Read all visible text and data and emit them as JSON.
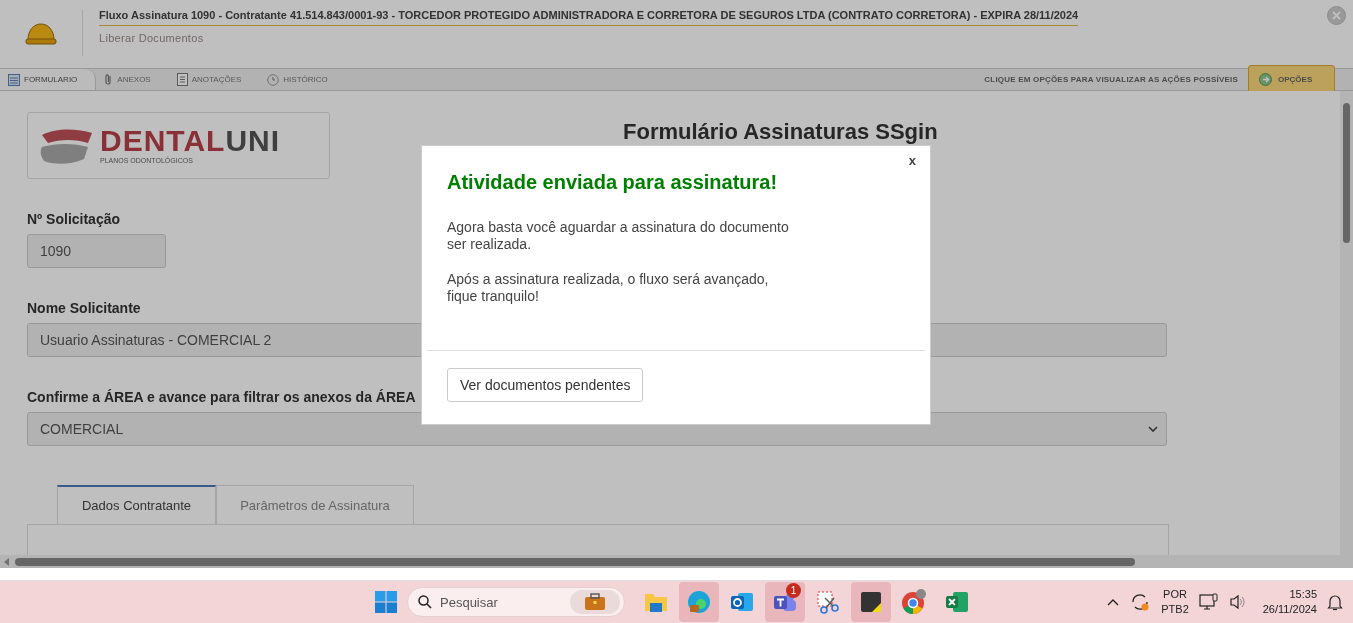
{
  "header": {
    "title": "Fluxo Assinatura 1090 - Contratante 41.514.843/0001-93 - TORCEDOR PROTEGIDO ADMINISTRADORA E CORRETORA DE SEGUROS LTDA (CONTRATO CORRETORA) - EXPIRA 28/11/2024",
    "subtitle": "Liberar Documentos"
  },
  "tabs": [
    {
      "label": "FORMULARIO",
      "kind": "form",
      "selected": true
    },
    {
      "label": "ANEXOS",
      "kind": "clip",
      "selected": false
    },
    {
      "label": "ANOTAÇÕES",
      "kind": "notes",
      "selected": false
    },
    {
      "label": "HISTÓRICO",
      "kind": "clock",
      "selected": false
    }
  ],
  "hint": "CLIQUE EM OPÇÕES PARA VISUALIZAR AS AÇÕES POSSÍVEIS",
  "options_button": "OPÇÕES",
  "logo": {
    "brand_first": "DENTAL",
    "brand_second": "UNI",
    "tagline": "PLANOS ODONTOLÓGICOS"
  },
  "form": {
    "title": "Formulário Assinaturas SSgin",
    "fields": [
      {
        "label": "Nº Solicitação",
        "value": "1090",
        "kind": "short"
      },
      {
        "label": "Nome Solicitante",
        "value": "Usuario Assinaturas - COMERCIAL 2",
        "kind": "wide"
      },
      {
        "label": "Confirme a ÁREA e avance para filtrar os anexos da ÁREA",
        "value": "COMERCIAL",
        "kind": "select"
      }
    ],
    "subtabs": [
      {
        "label": "Dados Contratante",
        "selected": true
      },
      {
        "label": "Parâmetros de Assinatura",
        "selected": false
      }
    ]
  },
  "modal": {
    "close": "x",
    "title": "Atividade enviada para assinatura!",
    "paragraphs": [
      "Agora basta você aguardar a assinatura do documento\nser realizada.",
      "Após a assinatura realizada, o fluxo será avançado,\nfique tranquilo!"
    ],
    "button": "Ver documentos pendentes"
  },
  "taskbar": {
    "search_placeholder": "Pesquisar",
    "apps": [
      {
        "kind": "explorer",
        "highlighted": false
      },
      {
        "kind": "edge",
        "highlighted": true
      },
      {
        "kind": "outlook",
        "highlighted": false
      },
      {
        "kind": "teams",
        "highlighted": true,
        "badge": "1"
      },
      {
        "kind": "snip",
        "highlighted": false
      },
      {
        "kind": "sticky",
        "highlighted": true
      },
      {
        "kind": "chrome",
        "highlighted": false
      },
      {
        "kind": "excel",
        "highlighted": false
      }
    ],
    "language": "POR",
    "layout": "PTB2",
    "time": "15:35",
    "date": "26/11/2024"
  }
}
